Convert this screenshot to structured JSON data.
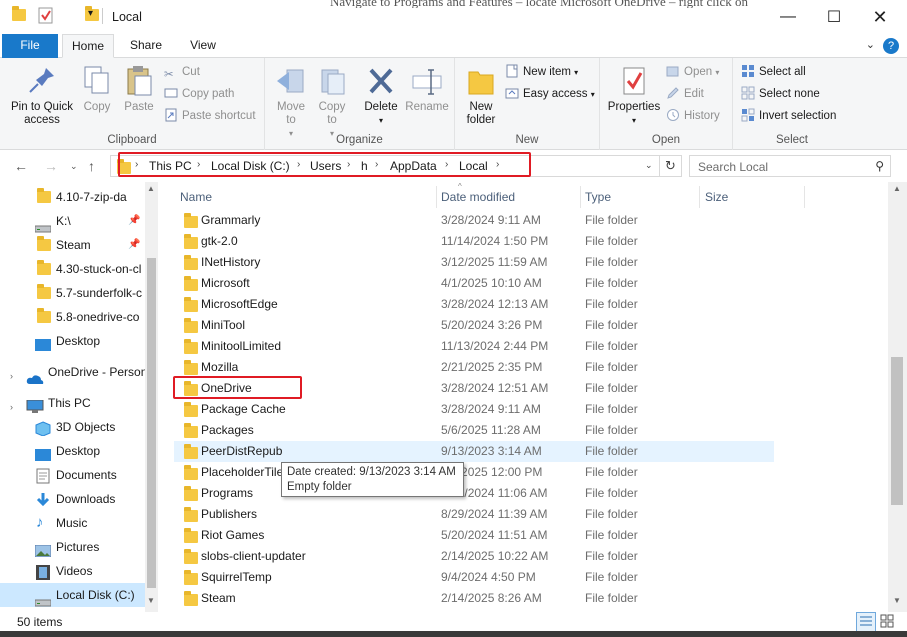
{
  "window": {
    "title": "Local",
    "background_text": "Navigate to Programs and Features – locate Microsoft OneDrive – right click on"
  },
  "ribbon_tabs": [
    "File",
    "Home",
    "Share",
    "View"
  ],
  "ribbon": {
    "clipboard": {
      "pin_label": "Pin to Quick access",
      "copy_label": "Copy",
      "paste_label": "Paste",
      "cut_label": "Cut",
      "copy_path_label": "Copy path",
      "paste_shortcut_label": "Paste shortcut",
      "group_label": "Clipboard"
    },
    "organize": {
      "move_to_label": "Move to",
      "copy_to_label": "Copy to",
      "delete_label": "Delete",
      "rename_label": "Rename",
      "group_label": "Organize"
    },
    "new": {
      "new_folder_label": "New folder",
      "new_item_label": "New item",
      "easy_access_label": "Easy access",
      "group_label": "New"
    },
    "open": {
      "properties_label": "Properties",
      "open_label": "Open",
      "edit_label": "Edit",
      "history_label": "History",
      "group_label": "Open"
    },
    "select": {
      "select_all_label": "Select all",
      "select_none_label": "Select none",
      "invert_label": "Invert selection",
      "group_label": "Select"
    }
  },
  "address": {
    "crumbs": [
      "This PC",
      "Local Disk (C:)",
      "Users",
      "h",
      "AppData",
      "Local"
    ],
    "search_placeholder": "Search Local"
  },
  "nav_pane": {
    "items": [
      {
        "label": "4.10-7-zip-da",
        "icon": "folder-icon",
        "pinned": false
      },
      {
        "label": "K:\\",
        "icon": "drive-icon",
        "pinned": true
      },
      {
        "label": "Steam",
        "icon": "folder-icon",
        "pinned": true
      },
      {
        "label": "4.30-stuck-on-cl",
        "icon": "folder-icon",
        "pinned": false
      },
      {
        "label": "5.7-sunderfolk-c",
        "icon": "folder-icon",
        "pinned": false
      },
      {
        "label": "5.8-onedrive-co",
        "icon": "folder-icon",
        "pinned": false
      },
      {
        "label": "Desktop",
        "icon": "desktop-icon",
        "pinned": false
      },
      {
        "label": "OneDrive - Person",
        "icon": "cloud-icon",
        "pinned": false
      },
      {
        "label": "This PC",
        "icon": "computer-icon",
        "pinned": false
      },
      {
        "label": "3D Objects",
        "icon": "cube-icon",
        "pinned": false
      },
      {
        "label": "Desktop",
        "icon": "desktop-icon",
        "pinned": false
      },
      {
        "label": "Documents",
        "icon": "document-icon",
        "pinned": false
      },
      {
        "label": "Downloads",
        "icon": "download-icon",
        "pinned": false
      },
      {
        "label": "Music",
        "icon": "music-icon",
        "pinned": false
      },
      {
        "label": "Pictures",
        "icon": "picture-icon",
        "pinned": false
      },
      {
        "label": "Videos",
        "icon": "video-icon",
        "pinned": false
      },
      {
        "label": "Local Disk (C:)",
        "icon": "drive-icon",
        "pinned": false
      }
    ]
  },
  "columns": {
    "name": "Name",
    "date": "Date modified",
    "type": "Type",
    "size": "Size"
  },
  "files": [
    {
      "name": "Grammarly",
      "date": "3/28/2024 9:11 AM",
      "type": "File folder"
    },
    {
      "name": "gtk-2.0",
      "date": "11/14/2024 1:50 PM",
      "type": "File folder"
    },
    {
      "name": "INetHistory",
      "date": "3/12/2025 11:59 AM",
      "type": "File folder"
    },
    {
      "name": "Microsoft",
      "date": "4/1/2025 10:10 AM",
      "type": "File folder"
    },
    {
      "name": "MicrosoftEdge",
      "date": "3/28/2024 12:13 AM",
      "type": "File folder"
    },
    {
      "name": "MiniTool",
      "date": "5/20/2024 3:26 PM",
      "type": "File folder"
    },
    {
      "name": "MinitoolLimited",
      "date": "11/13/2024 2:44 PM",
      "type": "File folder"
    },
    {
      "name": "Mozilla",
      "date": "2/21/2025 2:35 PM",
      "type": "File folder"
    },
    {
      "name": "OneDrive",
      "date": "3/28/2024 12:51 AM",
      "type": "File folder"
    },
    {
      "name": "Package Cache",
      "date": "3/28/2024 9:11 AM",
      "type": "File folder"
    },
    {
      "name": "Packages",
      "date": "5/6/2025 11:28 AM",
      "type": "File folder"
    },
    {
      "name": "PeerDistRepub",
      "date": "9/13/2023 3:14 AM",
      "type": "File folder"
    },
    {
      "name": "PlaceholderTileLogoFolder",
      "date": "5/7/2025 12:00 PM",
      "type": "File folder"
    },
    {
      "name": "Programs",
      "date": "4/30/2024 11:06 AM",
      "type": "File folder"
    },
    {
      "name": "Publishers",
      "date": "8/29/2024 11:39 AM",
      "type": "File folder"
    },
    {
      "name": "Riot Games",
      "date": "5/20/2024 11:51 AM",
      "type": "File folder"
    },
    {
      "name": "slobs-client-updater",
      "date": "2/14/2025 10:22 AM",
      "type": "File folder"
    },
    {
      "name": "SquirrelTemp",
      "date": "9/4/2024 4:50 PM",
      "type": "File folder"
    },
    {
      "name": "Steam",
      "date": "2/14/2025 8:26 AM",
      "type": "File folder"
    }
  ],
  "tooltip": {
    "line1": "Date created: 9/13/2023 3:14 AM",
    "line2": "Empty folder"
  },
  "status": {
    "item_count": "50 items"
  },
  "colors": {
    "accent": "#1979ca",
    "folder": "#f5c842",
    "highlight_red": "#e01b24",
    "hover_row": "#e5f3ff",
    "selected_nav": "#cce8ff"
  }
}
